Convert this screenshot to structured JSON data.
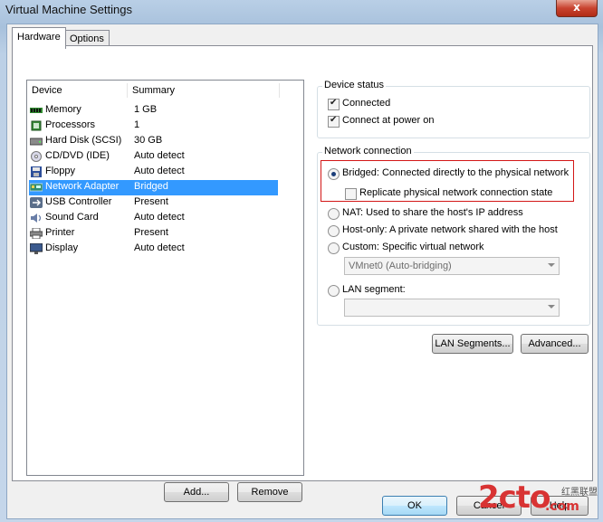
{
  "window": {
    "title": "Virtual Machine Settings",
    "close_glyph": "x"
  },
  "tabs": [
    {
      "label": "Hardware",
      "active": true
    },
    {
      "label": "Options",
      "active": false
    }
  ],
  "hardware": {
    "col_device": "Device",
    "col_summary": "Summary",
    "devices": [
      {
        "name": "Memory",
        "summary": "1 GB",
        "icon": "memory-icon"
      },
      {
        "name": "Processors",
        "summary": "1",
        "icon": "processor-icon"
      },
      {
        "name": "Hard Disk (SCSI)",
        "summary": "30 GB",
        "icon": "hard-disk-icon"
      },
      {
        "name": "CD/DVD (IDE)",
        "summary": "Auto detect",
        "icon": "cd-dvd-icon"
      },
      {
        "name": "Floppy",
        "summary": "Auto detect",
        "icon": "floppy-icon"
      },
      {
        "name": "Network Adapter",
        "summary": "Bridged",
        "icon": "network-adapter-icon",
        "selected": true
      },
      {
        "name": "USB Controller",
        "summary": "Present",
        "icon": "usb-icon"
      },
      {
        "name": "Sound Card",
        "summary": "Auto detect",
        "icon": "sound-icon"
      },
      {
        "name": "Printer",
        "summary": "Present",
        "icon": "printer-icon"
      },
      {
        "name": "Display",
        "summary": "Auto detect",
        "icon": "display-icon"
      }
    ],
    "add_label": "Add...",
    "remove_label": "Remove"
  },
  "device_status": {
    "title": "Device status",
    "connected": {
      "label": "Connected",
      "checked": true
    },
    "connect_power_on": {
      "label": "Connect at power on",
      "checked": true
    }
  },
  "network": {
    "title": "Network connection",
    "bridged": {
      "label": "Bridged: Connected directly to the physical network",
      "selected": true
    },
    "replicate": {
      "label": "Replicate physical network connection state",
      "checked": false
    },
    "nat": {
      "label": "NAT: Used to share the host's IP address"
    },
    "host_only": {
      "label": "Host-only: A private network shared with the host"
    },
    "custom": {
      "label": "Custom: Specific virtual network"
    },
    "custom_value": "VMnet0 (Auto-bridging)",
    "lan_segment": {
      "label": "LAN segment:"
    },
    "lan_segment_value": "",
    "lan_segments_button": "LAN Segments...",
    "advanced_button": "Advanced..."
  },
  "footer": {
    "ok": "OK",
    "cancel": "Cancel",
    "help": "Help"
  },
  "watermark": {
    "text": "2cto",
    "suffix": ".com",
    "cjk": "红黑联盟"
  },
  "colors": {
    "selection": "#3399ff",
    "highlight_box": "#d31717",
    "close": "#c8432f"
  }
}
